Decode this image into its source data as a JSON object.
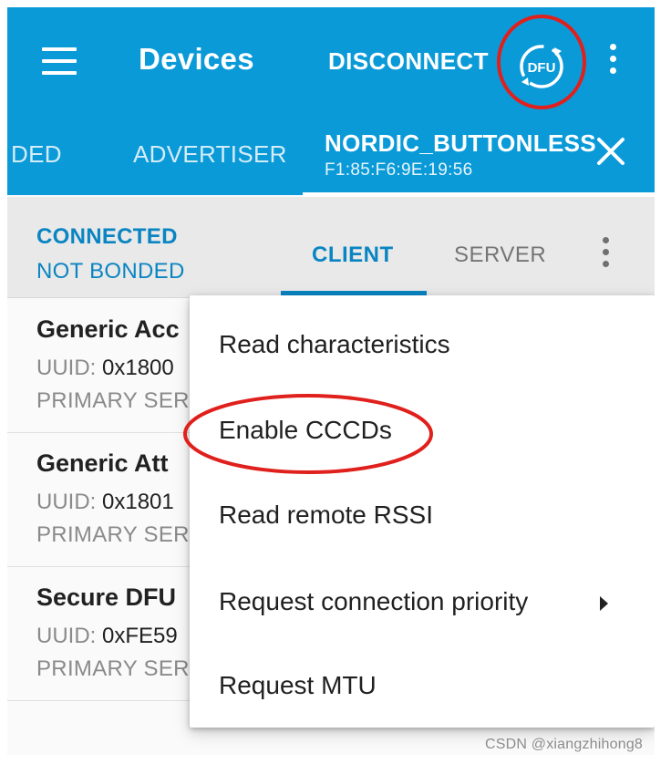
{
  "app_bar": {
    "title": "Devices",
    "disconnect_label": "DISCONNECT",
    "dfu_label": "DFU"
  },
  "device_tabs": {
    "partial_tab": "DED",
    "advertiser": "ADVERTISER",
    "active_device_name": "NORDIC_BUTTONLESS",
    "active_device_address": "F1:85:F6:9E:19:56"
  },
  "connection": {
    "state": "CONNECTED",
    "bond_state": "NOT BONDED"
  },
  "sub_tabs": {
    "client": "CLIENT",
    "server": "SERVER"
  },
  "services": [
    {
      "name": "Generic Acc",
      "uuid_label": "UUID:",
      "uuid": "0x1800",
      "type": "PRIMARY SER"
    },
    {
      "name": "Generic Att",
      "uuid_label": "UUID:",
      "uuid": "0x1801",
      "type": "PRIMARY SER"
    },
    {
      "name": "Secure DFU",
      "uuid_label": "UUID:",
      "uuid": "0xFE59",
      "type": "PRIMARY SER"
    }
  ],
  "menu": {
    "items": [
      {
        "label": "Read characteristics"
      },
      {
        "label": "Enable CCCDs"
      },
      {
        "label": "Read remote RSSI"
      },
      {
        "label": "Request connection priority"
      },
      {
        "label": "Request MTU"
      }
    ]
  },
  "watermark": "CSDN @xiangzhihong8",
  "colors": {
    "app_bar": "#0a9ad8",
    "accent": "#0a85c2",
    "highlight_circle": "#e0201c"
  },
  "icons": {
    "menu": "hamburger-icon",
    "dfu": "dfu-icon",
    "more": "overflow-icon",
    "close": "close-icon",
    "submenu": "arrow-right-icon"
  }
}
